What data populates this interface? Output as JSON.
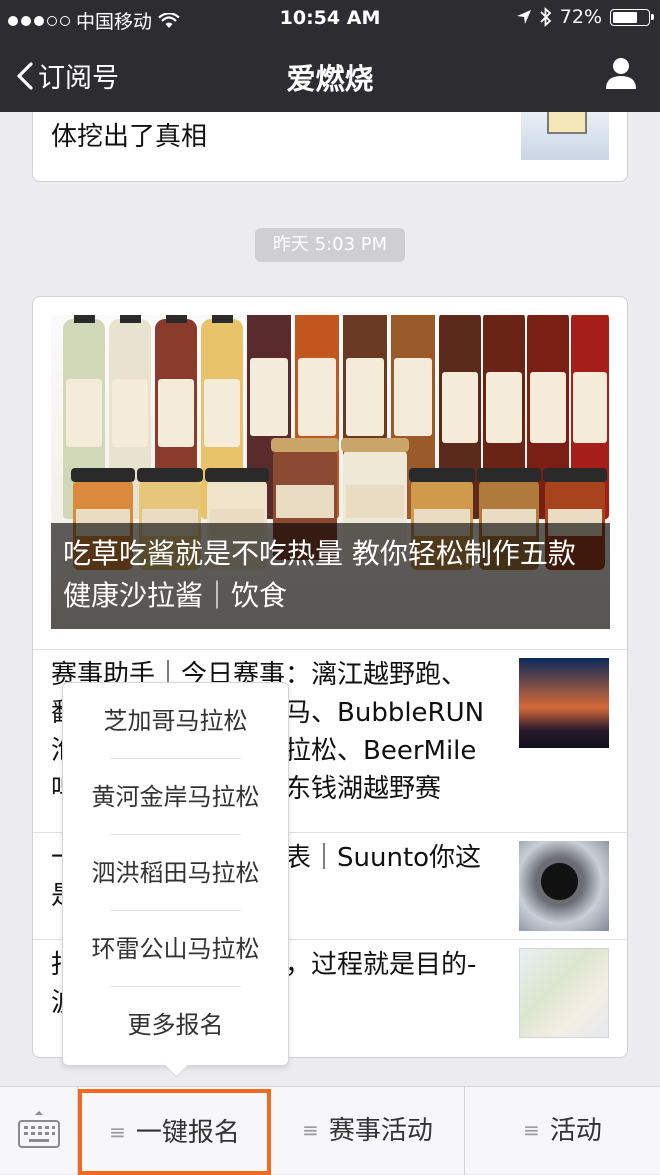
{
  "status_bar": {
    "carrier": "中国移动",
    "time": "10:54 AM",
    "battery": "72%",
    "battery_level": 0.72
  },
  "nav": {
    "back_label": "订阅号",
    "title": "爱燃烧",
    "user_icon": "person-icon"
  },
  "feed": {
    "prev_article_tail": "体挖出了真相",
    "timestamp": "昨天 5:03 PM",
    "hero_caption": "吃草吃酱就是不吃热量 教你轻松制作五款健康沙拉酱｜饮食",
    "articles": [
      {
        "title": "赛事助手｜今日赛事：漓江越野跑、鄱阳湖马拉松、成都马、BubbleRUN泡泡跑、仁寿半程马拉松、BeerMile啤酒一英里、宁波环东钱湖越野赛"
      },
      {
        "title": "一年都没摸过的运动表｜Suunto你这是在干什么？"
      },
      {
        "title": "报名即是参赛的开始，过程就是目的-波马记"
      }
    ]
  },
  "popup_menu": {
    "items": [
      "芝加哥马拉松",
      "黄河金岸马拉松",
      "泗洪稻田马拉松",
      "环雷公山马拉松",
      "更多报名"
    ]
  },
  "bottom_menu": {
    "keyboard_icon": "keyboard-icon",
    "tabs": [
      {
        "label": "一键报名"
      },
      {
        "label": "赛事活动"
      },
      {
        "label": "活动"
      }
    ],
    "active_outline_color": "#f06a22"
  },
  "colors": {
    "nav_bg": "#2d2d31",
    "page_bg": "#ececee"
  }
}
